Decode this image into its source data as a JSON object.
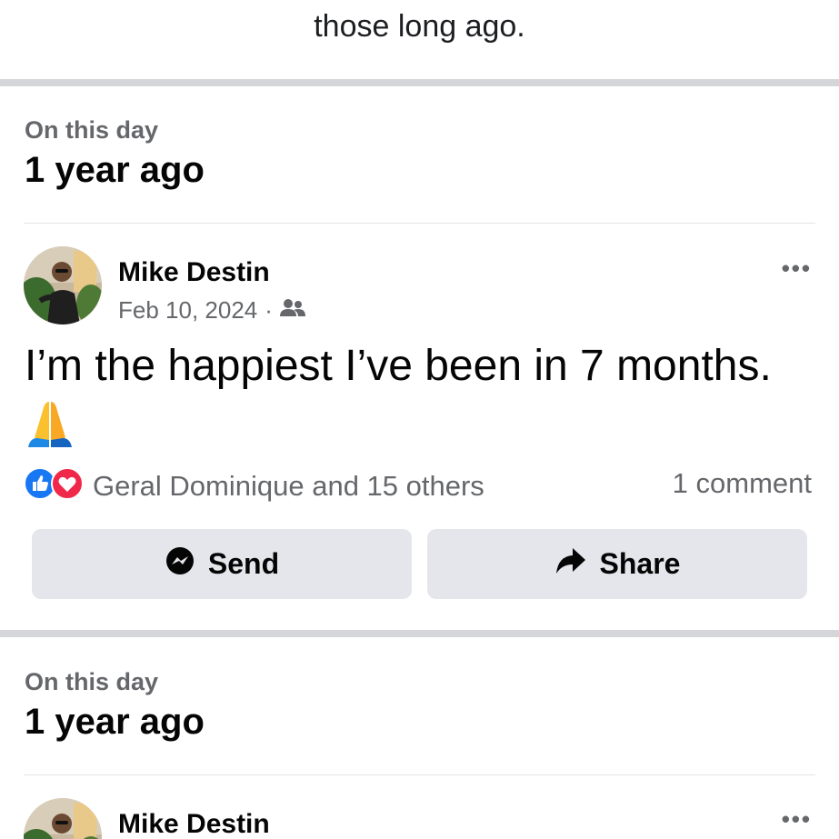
{
  "top_text": "those long ago.",
  "sections": [
    {
      "kicker": "On this day",
      "title": "1 year ago",
      "post": {
        "author": "Mike Destin",
        "date": "Feb 10, 2024",
        "separator": "·",
        "audience_icon": "friends-icon",
        "more_label": "•••",
        "text": "I’m the happiest I’ve been in 7 months.",
        "emoji": "folded-hands",
        "reactions_label": "Geral Dominique and 15 others",
        "comments_label": "1 comment",
        "send_label": "Send",
        "share_label": "Share"
      }
    },
    {
      "kicker": "On this day",
      "title": "1 year ago",
      "post": {
        "author": "Mike Destin",
        "more_label": "•••"
      }
    }
  ],
  "colors": {
    "like_blue": "#1877f2",
    "love_red": "#f02849",
    "button_gray": "#e4e6eb",
    "secondary_text": "#65676b"
  }
}
